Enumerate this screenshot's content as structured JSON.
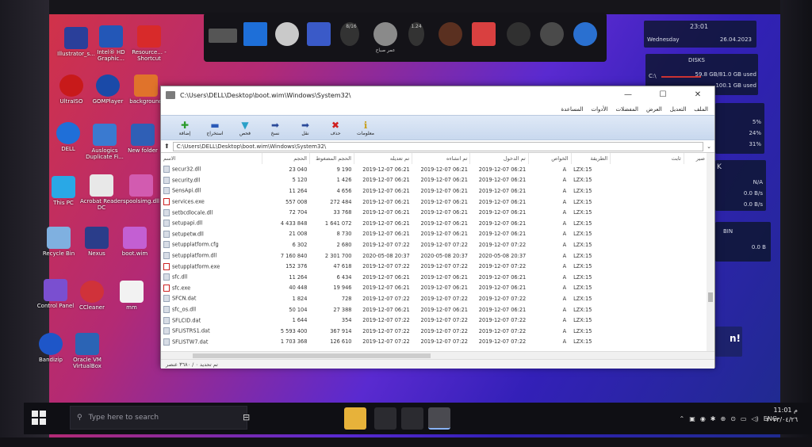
{
  "desktop": {
    "icons": [
      "Illustrator_s...",
      "Intel® HD Graphic...",
      "Resource... - Shortcut",
      "UltraISO",
      "GOMPlayer",
      "background",
      "DELL",
      "Auslogics Duplicate Fi...",
      "New folder",
      "This PC",
      "Acrobat Reader DC",
      "spoolsimg.dll",
      "Recycle Bin",
      "Nexus",
      "boot.wim",
      "Control Panel",
      "CCleaner",
      "mm",
      "Bandizip",
      "Oracle VM VirtualBox"
    ]
  },
  "dock": {
    "item_a": "8/16",
    "item_b": "1.24",
    "help_label": "عمر صباح"
  },
  "widgets": {
    "clock_time": "23:01",
    "clock_day": "Wednesday",
    "clock_date": "26.04.2023",
    "disks_title": "DISKS",
    "disk_c_label": "C:\\",
    "disk_c_value": "59.8 GB/81.0 GB used",
    "disk_d_value": "100.1 GB used",
    "cpu": [
      "5%",
      "24%",
      "31%"
    ],
    "net_letter": "K",
    "net": [
      "N/A",
      "0.0 B/s",
      "0.0 B/s"
    ],
    "bin_title": "BIN",
    "bin_value": "0.0 B",
    "fragment": "n!"
  },
  "window": {
    "title": "C:\\Users\\DELL\\Desktop\\boot.wim\\Windows\\System32\\",
    "minimize": "—",
    "maximize": "☐",
    "close": "✕",
    "menus": [
      "المساعدة",
      "الأدوات",
      "المفضلات",
      "العرض",
      "التعديل",
      "الملف"
    ],
    "toolbar": [
      "إضافة",
      "استخراج",
      "فحص",
      "نسخ",
      "نقل",
      "حذف",
      "معلومات"
    ],
    "path": "C:\\Users\\DELL\\Desktop\\boot.wim\\Windows\\System32\\",
    "columns": [
      "الاسم",
      "الحجم",
      "الحجم المضغوط",
      "تم تعديله",
      "تم انشاءه",
      "تم الدخول",
      "الخواص",
      "الطريقة",
      "ثابت",
      "صير"
    ],
    "files": [
      {
        "name": "secur32.dll",
        "size": "23 040",
        "packed": "9 190",
        "modified": "2019-12-07 06:21",
        "created": "2019-12-07 06:21",
        "accessed": "2019-12-07 06:21",
        "attr": "A",
        "method": "LZX:15",
        "type": "dll"
      },
      {
        "name": "security.dll",
        "size": "5 120",
        "packed": "1 426",
        "modified": "2019-12-07 06:21",
        "created": "2019-12-07 06:21",
        "accessed": "2019-12-07 06:21",
        "attr": "A",
        "method": "LZX:15",
        "type": "dll"
      },
      {
        "name": "SensApi.dll",
        "size": "11 264",
        "packed": "4 656",
        "modified": "2019-12-07 06:21",
        "created": "2019-12-07 06:21",
        "accessed": "2019-12-07 06:21",
        "attr": "A",
        "method": "LZX:15",
        "type": "dll"
      },
      {
        "name": "services.exe",
        "size": "557 008",
        "packed": "272 484",
        "modified": "2019-12-07 06:21",
        "created": "2019-12-07 06:21",
        "accessed": "2019-12-07 06:21",
        "attr": "A",
        "method": "LZX:15",
        "type": "exe"
      },
      {
        "name": "setbcdlocale.dll",
        "size": "72 704",
        "packed": "33 768",
        "modified": "2019-12-07 06:21",
        "created": "2019-12-07 06:21",
        "accessed": "2019-12-07 06:21",
        "attr": "A",
        "method": "LZX:15",
        "type": "dll"
      },
      {
        "name": "setupapi.dll",
        "size": "4 433 848",
        "packed": "1 641 072",
        "modified": "2019-12-07 06:21",
        "created": "2019-12-07 06:21",
        "accessed": "2019-12-07 06:21",
        "attr": "A",
        "method": "LZX:15",
        "type": "dll"
      },
      {
        "name": "setupetw.dll",
        "size": "21 008",
        "packed": "8 730",
        "modified": "2019-12-07 06:21",
        "created": "2019-12-07 06:21",
        "accessed": "2019-12-07 06:21",
        "attr": "A",
        "method": "LZX:15",
        "type": "dll"
      },
      {
        "name": "setupplatform.cfg",
        "size": "6 302",
        "packed": "2 680",
        "modified": "2019-12-07 07:22",
        "created": "2019-12-07 07:22",
        "accessed": "2019-12-07 07:22",
        "attr": "A",
        "method": "LZX:15",
        "type": "dll"
      },
      {
        "name": "setupplatform.dll",
        "size": "7 160 840",
        "packed": "2 301 700",
        "modified": "2020-05-08 20:37",
        "created": "2020-05-08 20:37",
        "accessed": "2020-05-08 20:37",
        "attr": "A",
        "method": "LZX:15",
        "type": "dll"
      },
      {
        "name": "setupplatform.exe",
        "size": "152 376",
        "packed": "47 618",
        "modified": "2019-12-07 07:22",
        "created": "2019-12-07 07:22",
        "accessed": "2019-12-07 07:22",
        "attr": "A",
        "method": "LZX:15",
        "type": "exe"
      },
      {
        "name": "sfc.dll",
        "size": "11 264",
        "packed": "6 434",
        "modified": "2019-12-07 06:21",
        "created": "2019-12-07 06:21",
        "accessed": "2019-12-07 06:21",
        "attr": "A",
        "method": "LZX:15",
        "type": "dll"
      },
      {
        "name": "sfc.exe",
        "size": "40 448",
        "packed": "19 946",
        "modified": "2019-12-07 06:21",
        "created": "2019-12-07 06:21",
        "accessed": "2019-12-07 06:21",
        "attr": "A",
        "method": "LZX:15",
        "type": "exe"
      },
      {
        "name": "SFCN.dat",
        "size": "1 824",
        "packed": "728",
        "modified": "2019-12-07 07:22",
        "created": "2019-12-07 07:22",
        "accessed": "2019-12-07 07:22",
        "attr": "A",
        "method": "LZX:15",
        "type": "dll"
      },
      {
        "name": "sfc_os.dll",
        "size": "50 104",
        "packed": "27 388",
        "modified": "2019-12-07 06:21",
        "created": "2019-12-07 06:21",
        "accessed": "2019-12-07 06:21",
        "attr": "A",
        "method": "LZX:15",
        "type": "dll"
      },
      {
        "name": "SFLCID.dat",
        "size": "1 644",
        "packed": "354",
        "modified": "2019-12-07 07:22",
        "created": "2019-12-07 07:22",
        "accessed": "2019-12-07 07:22",
        "attr": "A",
        "method": "LZX:15",
        "type": "dll"
      },
      {
        "name": "SFLISTRS1.dat",
        "size": "5 593 400",
        "packed": "367 914",
        "modified": "2019-12-07 07:22",
        "created": "2019-12-07 07:22",
        "accessed": "2019-12-07 07:22",
        "attr": "A",
        "method": "LZX:15",
        "type": "dll"
      },
      {
        "name": "SFLISTW7.dat",
        "size": "1 703 368",
        "packed": "126 610",
        "modified": "2019-12-07 07:22",
        "created": "2019-12-07 07:22",
        "accessed": "2019-12-07 07:22",
        "attr": "A",
        "method": "LZX:15",
        "type": "dll"
      }
    ],
    "status": "تم تحديد ٠ / ٣٦٨٠ عنصر"
  },
  "taskbar": {
    "search_placeholder": "Type here to search",
    "language": "ENG",
    "time": "11:01 م",
    "date": "٢٠٢٣/٠٤/٢٦"
  }
}
